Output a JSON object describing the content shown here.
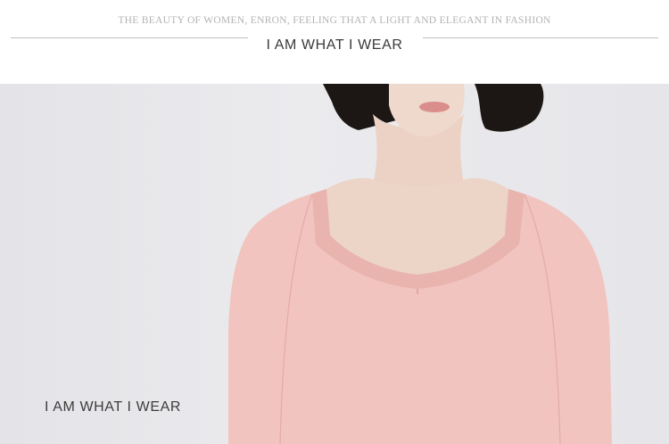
{
  "header": {
    "tagline": "THE BEAUTY OF WOMEN, ENRON, FEELING THAT A LIGHT AND ELEGANT IN FASHION",
    "headline": "I AM WHAT I WEAR"
  },
  "banner": {
    "caption": "I AM WHAT I WEAR"
  },
  "colors": {
    "background": "#ffffff",
    "banner_background": "#e8e8eb",
    "sweater": "#f2c4c0",
    "skin": "#ecd3c6",
    "hair": "#1c1614",
    "lips": "#d98e8c",
    "rule": "#bdbdbd"
  }
}
